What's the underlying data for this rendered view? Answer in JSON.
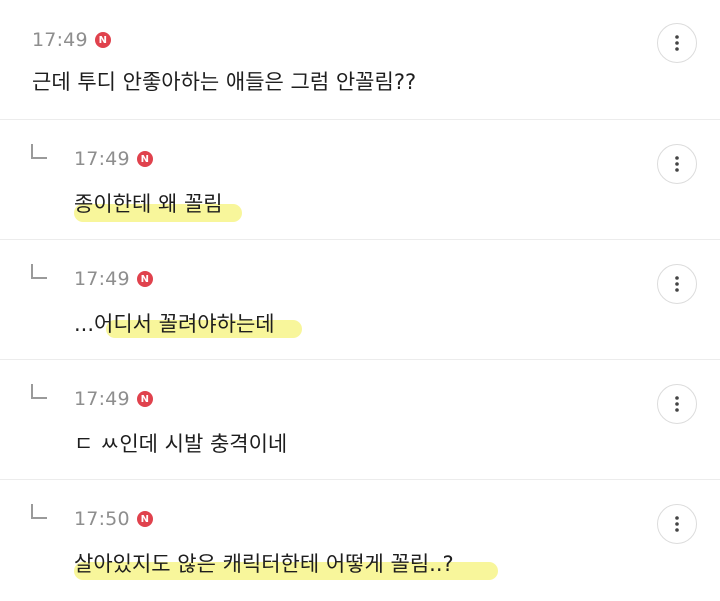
{
  "badge_label": "N",
  "more_icon": "more-vertical-icon",
  "comments": [
    {
      "time": "17:49",
      "text": "근데 투디 안좋아하는 애들은 그럼 안꼴림??",
      "reply": false
    },
    {
      "time": "17:49",
      "text": "종이한테 왜 꼴림",
      "reply": true
    },
    {
      "time": "17:49",
      "text": "...어디서 꼴려야하는데",
      "reply": true
    },
    {
      "time": "17:49",
      "text": "ㄷ ㅆ인데 시발 충격이네",
      "reply": true
    },
    {
      "time": "17:50",
      "text": "살아있지도 않은 캐릭터한테 어떻게 꼴림..?",
      "reply": true
    }
  ],
  "colors": {
    "badge": "#e0424d",
    "highlight": "#f7f58a",
    "divider": "#ececec"
  }
}
